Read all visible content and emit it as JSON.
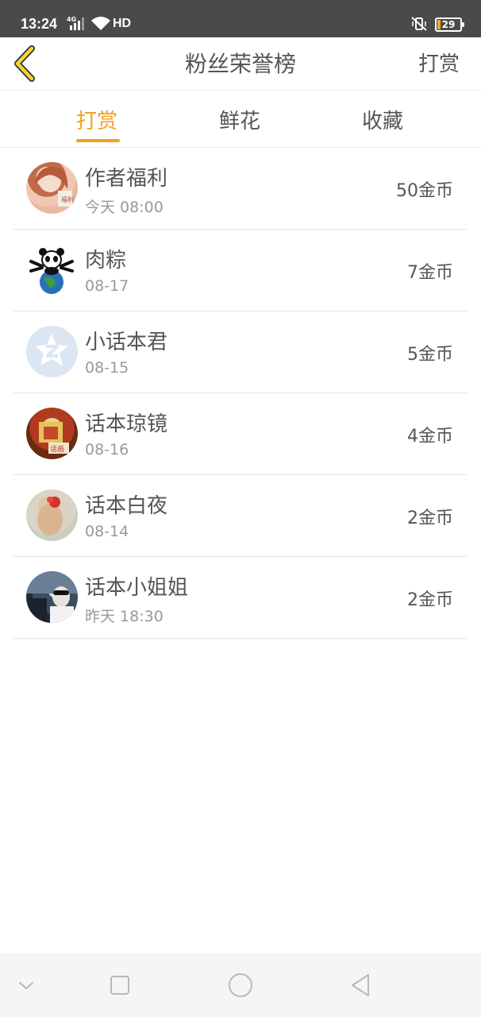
{
  "status": {
    "time": "13:24",
    "network": "4G",
    "hd": "HD",
    "battery": "29"
  },
  "header": {
    "title": "粉丝荣誉榜",
    "action": "打赏"
  },
  "tabs": [
    {
      "label": "打赏",
      "active": true
    },
    {
      "label": "鲜花",
      "active": false
    },
    {
      "label": "收藏",
      "active": false
    }
  ],
  "list": [
    {
      "name": "作者福利",
      "time": "今天 08:00",
      "amount": "50金币",
      "avatar": "anime-girl-avatar"
    },
    {
      "name": "肉粽",
      "time": "08-17",
      "amount": "7金币",
      "avatar": "panda-globe-avatar"
    },
    {
      "name": "小话本君",
      "time": "08-15",
      "amount": "5金币",
      "avatar": "default-avatar"
    },
    {
      "name": "话本琼镜",
      "time": "08-16",
      "amount": "4金币",
      "avatar": "photo-avatar"
    },
    {
      "name": "话本白夜",
      "time": "08-14",
      "amount": "2金币",
      "avatar": "girl-flower-avatar"
    },
    {
      "name": "话本小姐姐",
      "time": "昨天 18:30",
      "amount": "2金币",
      "avatar": "car-photo-avatar"
    }
  ],
  "colors": {
    "accent": "#f5a01f",
    "back_arrow": "#f5d33a",
    "status_bar": "#4a4a4a"
  }
}
